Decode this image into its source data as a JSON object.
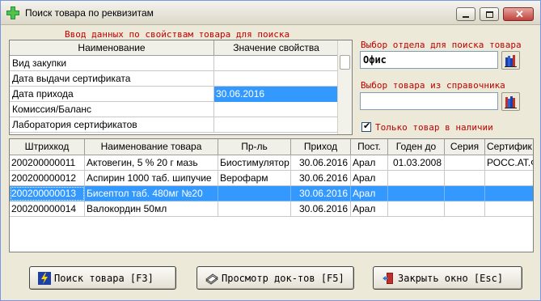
{
  "window": {
    "title": "Поиск товара по реквизитам"
  },
  "search_props": {
    "label": "Ввод данных по свойствам товара для поиска",
    "headers": {
      "name": "Наименование",
      "value": "Значение свойства"
    },
    "rows": [
      {
        "name": "Вид закупки",
        "value": ""
      },
      {
        "name": "Дата выдачи сертификата",
        "value": ""
      },
      {
        "name": "Дата прихода",
        "value": "30.06.2016"
      },
      {
        "name": "Комиссия/Баланс",
        "value": ""
      },
      {
        "name": "Лаборатория сертификатов",
        "value": ""
      }
    ]
  },
  "department": {
    "label": "Выбор отдела для поиска товара",
    "value": "Офис"
  },
  "catalog": {
    "label": "Выбор товара из справочника",
    "value": ""
  },
  "in_stock": {
    "label": "Только товар в наличии",
    "checked": true
  },
  "goods": {
    "headers": [
      "Штрихкод",
      "Наименование товара",
      "Пр-ль",
      "Приход",
      "Пост.",
      "Годен до",
      "Серия",
      "Сертифик"
    ],
    "rows": [
      [
        "200200000011",
        "Актовегин, 5 % 20 г мазь",
        "Биостимулятор",
        "30.06.2016",
        "Арал",
        "01.03.2008",
        "",
        "РОСС.АТ.Ф"
      ],
      [
        "200200000012",
        "Аспирин 1000 таб. шипучие",
        "Верофарм",
        "30.06.2016",
        "Арал",
        "",
        "",
        ""
      ],
      [
        "200200000013",
        "Бисептол таб. 480мг №20",
        "",
        "30.06.2016",
        "Арал",
        "",
        "",
        ""
      ],
      [
        "200200000014",
        "Валокордин 50мл",
        "",
        "30.06.2016",
        "Арал",
        "",
        "",
        ""
      ]
    ]
  },
  "buttons": {
    "search": "Поиск товара [F3]",
    "view_docs": "Просмотр док-тов [F5]",
    "close": "Закрыть окно [Esc]"
  },
  "colors": {
    "selection": "#3399ff",
    "label_red": "#c00000"
  }
}
